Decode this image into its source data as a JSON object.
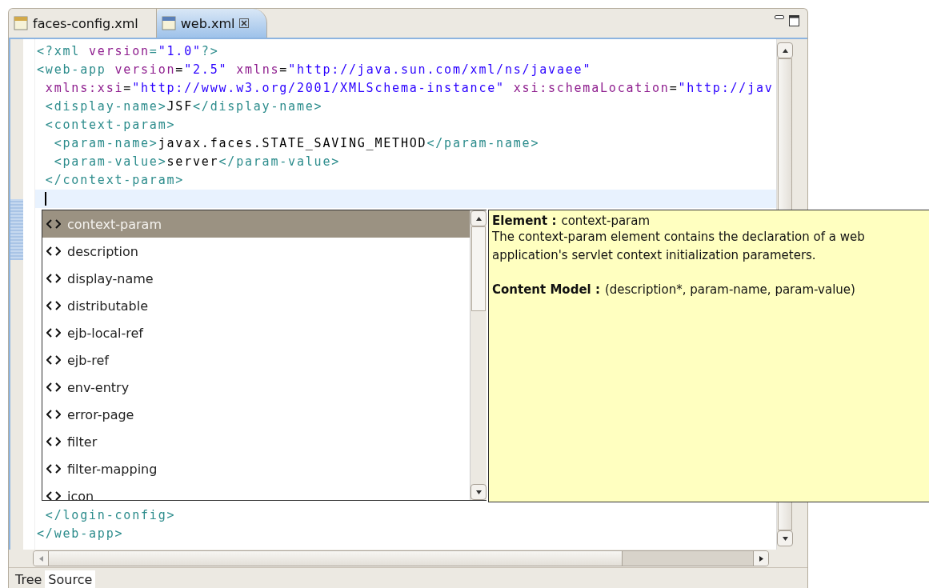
{
  "editor_tabs": [
    {
      "label": "faces-config.xml",
      "selected": false,
      "closable": false
    },
    {
      "label": "web.xml",
      "selected": true,
      "closable": true
    }
  ],
  "code_lines": [
    {
      "tokens": [
        {
          "kind": "tag",
          "text": "<?xml "
        },
        {
          "kind": "attr",
          "text": "version"
        },
        {
          "kind": "tag",
          "text": "="
        },
        {
          "kind": "value",
          "text": "\"1.0\""
        },
        {
          "kind": "tag",
          "text": "?>"
        }
      ]
    },
    {
      "tokens": [
        {
          "kind": "tag",
          "text": "<web-app "
        },
        {
          "kind": "attr",
          "text": "version"
        },
        {
          "kind": "plain",
          "text": "="
        },
        {
          "kind": "value",
          "text": "\"2.5\" "
        },
        {
          "kind": "attr",
          "text": "xmlns"
        },
        {
          "kind": "plain",
          "text": "="
        },
        {
          "kind": "value",
          "text": "\"http://java.sun.com/xml/ns/javaee\""
        }
      ]
    },
    {
      "tokens": [
        {
          "kind": "attr",
          "text": " xmlns:xsi"
        },
        {
          "kind": "plain",
          "text": "="
        },
        {
          "kind": "value",
          "text": "\"http://www.w3.org/2001/XMLSchema-instance\" "
        },
        {
          "kind": "attr",
          "text": "xsi:schemaLocation"
        },
        {
          "kind": "plain",
          "text": "="
        },
        {
          "kind": "value",
          "text": "\"http://jav"
        }
      ]
    },
    {
      "tokens": [
        {
          "kind": "tag",
          "text": " <display-name>"
        },
        {
          "kind": "plain",
          "text": "JSF"
        },
        {
          "kind": "tag",
          "text": "</display-name>"
        }
      ]
    },
    {
      "tokens": [
        {
          "kind": "tag",
          "text": " <context-param>"
        }
      ]
    },
    {
      "tokens": [
        {
          "kind": "tag",
          "text": "  <param-name>"
        },
        {
          "kind": "plain",
          "text": "javax.faces.STATE_SAVING_METHOD"
        },
        {
          "kind": "tag",
          "text": "</param-name>"
        }
      ]
    },
    {
      "tokens": [
        {
          "kind": "tag",
          "text": "  <param-value>"
        },
        {
          "kind": "plain",
          "text": "server"
        },
        {
          "kind": "tag",
          "text": "</param-value>"
        }
      ]
    },
    {
      "tokens": [
        {
          "kind": "tag",
          "text": " </context-param>"
        }
      ]
    }
  ],
  "trailing_lines": [
    {
      "tokens": [
        {
          "kind": "tag",
          "text": " </login-config>"
        }
      ]
    },
    {
      "tokens": [
        {
          "kind": "tag",
          "text": "</web-app>"
        }
      ]
    }
  ],
  "completion_items": [
    {
      "label": "context-param",
      "selected": true
    },
    {
      "label": "description",
      "selected": false
    },
    {
      "label": "display-name",
      "selected": false
    },
    {
      "label": "distributable",
      "selected": false
    },
    {
      "label": "ejb-local-ref",
      "selected": false
    },
    {
      "label": "ejb-ref",
      "selected": false
    },
    {
      "label": "env-entry",
      "selected": false
    },
    {
      "label": "error-page",
      "selected": false
    },
    {
      "label": "filter",
      "selected": false
    },
    {
      "label": "filter-mapping",
      "selected": false
    },
    {
      "label": "icon",
      "selected": false
    }
  ],
  "info": {
    "element_label": "Element :",
    "element_value": "context-param",
    "description": "The context-param element contains the declaration of a web application's servlet context initialization parameters.",
    "model_label": "Content Model :",
    "model_value": "(description*, param-name, param-value)"
  },
  "bottom_tabs": [
    {
      "label": "Tree",
      "selected": false
    },
    {
      "label": "Source",
      "selected": true
    }
  ]
}
